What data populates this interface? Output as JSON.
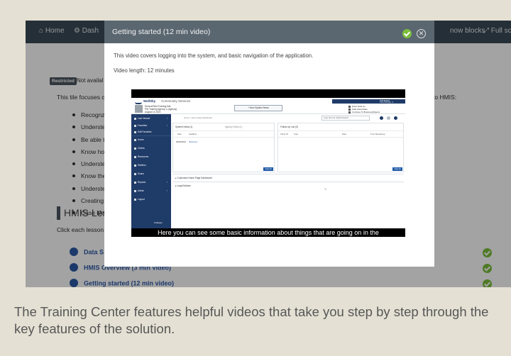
{
  "background_app": {
    "nav": [
      {
        "label": "Home",
        "icon": "home-icon"
      },
      {
        "label": "Dash",
        "icon": "dashboard-icon"
      },
      {
        "label": "now blocks",
        "icon": "blocks-icon"
      },
      {
        "label": "Full scr",
        "icon": "fullscreen-icon"
      }
    ],
    "restricted_badge": "Restricted",
    "not_available": "Not availal",
    "tile_focus": "This tile focuses c",
    "to_hmis": "to HMIS:",
    "bullets": [
      "Recognz",
      "Underste",
      "Be able t",
      "Know ho",
      "Underste",
      "Know the",
      "Underste",
      "Creating",
      "Case Ma"
    ],
    "section_title": "HMIS Less",
    "click_each": "Click each lesson",
    "lessons": [
      {
        "label": "Data S",
        "completed": true
      },
      {
        "label": "HMIS Overview (3 min video)",
        "completed": true
      },
      {
        "label": "Getting started (12 min video)",
        "completed": true
      }
    ]
  },
  "modal": {
    "title": "Getting started (12 min video)",
    "description": "This video covers logging into the system, and basic navigation of the application.",
    "video_length": "Video length: 12 minutes",
    "check_color": "#7bbf3a"
  },
  "video": {
    "app": {
      "logo": "WellSky",
      "logo_sub": "Community Services",
      "agency_lines": [
        "ServicePoint Training Site",
        "PIN Training Agency 1 (Agency)",
        "August 14 2023"
      ],
      "new_system_news": "+ New System News",
      "user_name": "Will Buffett",
      "user_sub": "Case Manager III",
      "quick_links": [
        "Enter Data As",
        "Start Data Mode",
        "Continue To BusinessObjects"
      ],
      "sidebar": [
        {
          "label": "Last Viewed",
          "arrow": "›"
        },
        {
          "label": "Favorites",
          "arrow": "›"
        },
        {
          "label": "Edit Favorites",
          "arrow": ""
        },
        {
          "label": "Home",
          "arrow": ""
        },
        {
          "label": "Clients",
          "arrow": ""
        },
        {
          "label": "Resources",
          "arrow": ""
        },
        {
          "label": "Shelters",
          "arrow": ""
        },
        {
          "label": "Scans",
          "arrow": ""
        },
        {
          "label": "Reports",
          "arrow": "›"
        },
        {
          "label": "Admin",
          "arrow": "›"
        },
        {
          "label": "Logout",
          "arrow": ""
        }
      ],
      "sidebar_collapse": "Collapse",
      "breadcrumb": "Home  >  Home Page Dashboard",
      "search_placeholder": "Type here for Global Search",
      "panel_left": {
        "title": "System News (1)",
        "sub": "Agency News (1)",
        "cols": [
          "Date",
          "Headline"
        ],
        "row_date": "09/18/2023",
        "row_headline": "Welcome!",
        "view_all": "View All"
      },
      "panel_right": {
        "title": "Follow Up List (0)",
        "cols": [
          "Client ID",
          "Type",
          "Date",
          "Time Remaining"
        ],
        "view_all": "View All"
      },
      "expanders": [
        "Customize Home Page Dashboard",
        "Legal Notices"
      ]
    },
    "caption": "Here you can see some basic information about things that are going on in the"
  },
  "footer": {
    "text": "The Training Center features helpful videos that take you step by step through the key features of the solution."
  }
}
